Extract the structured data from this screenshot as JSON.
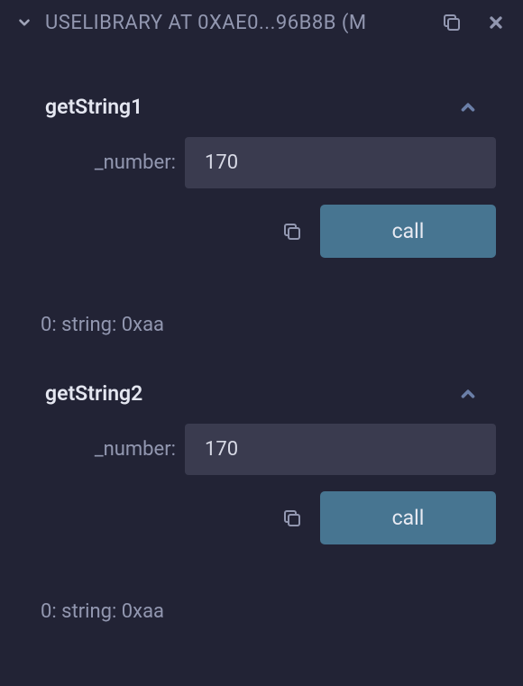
{
  "header": {
    "title": "USELIBRARY AT 0XAE0...96B8B (M"
  },
  "functions": [
    {
      "name": "getString1",
      "param_label": "_number:",
      "param_value": "170",
      "call_label": "call",
      "result": "0: string: 0xaa"
    },
    {
      "name": "getString2",
      "param_label": "_number:",
      "param_value": "170",
      "call_label": "call",
      "result": "0: string: 0xaa"
    }
  ]
}
